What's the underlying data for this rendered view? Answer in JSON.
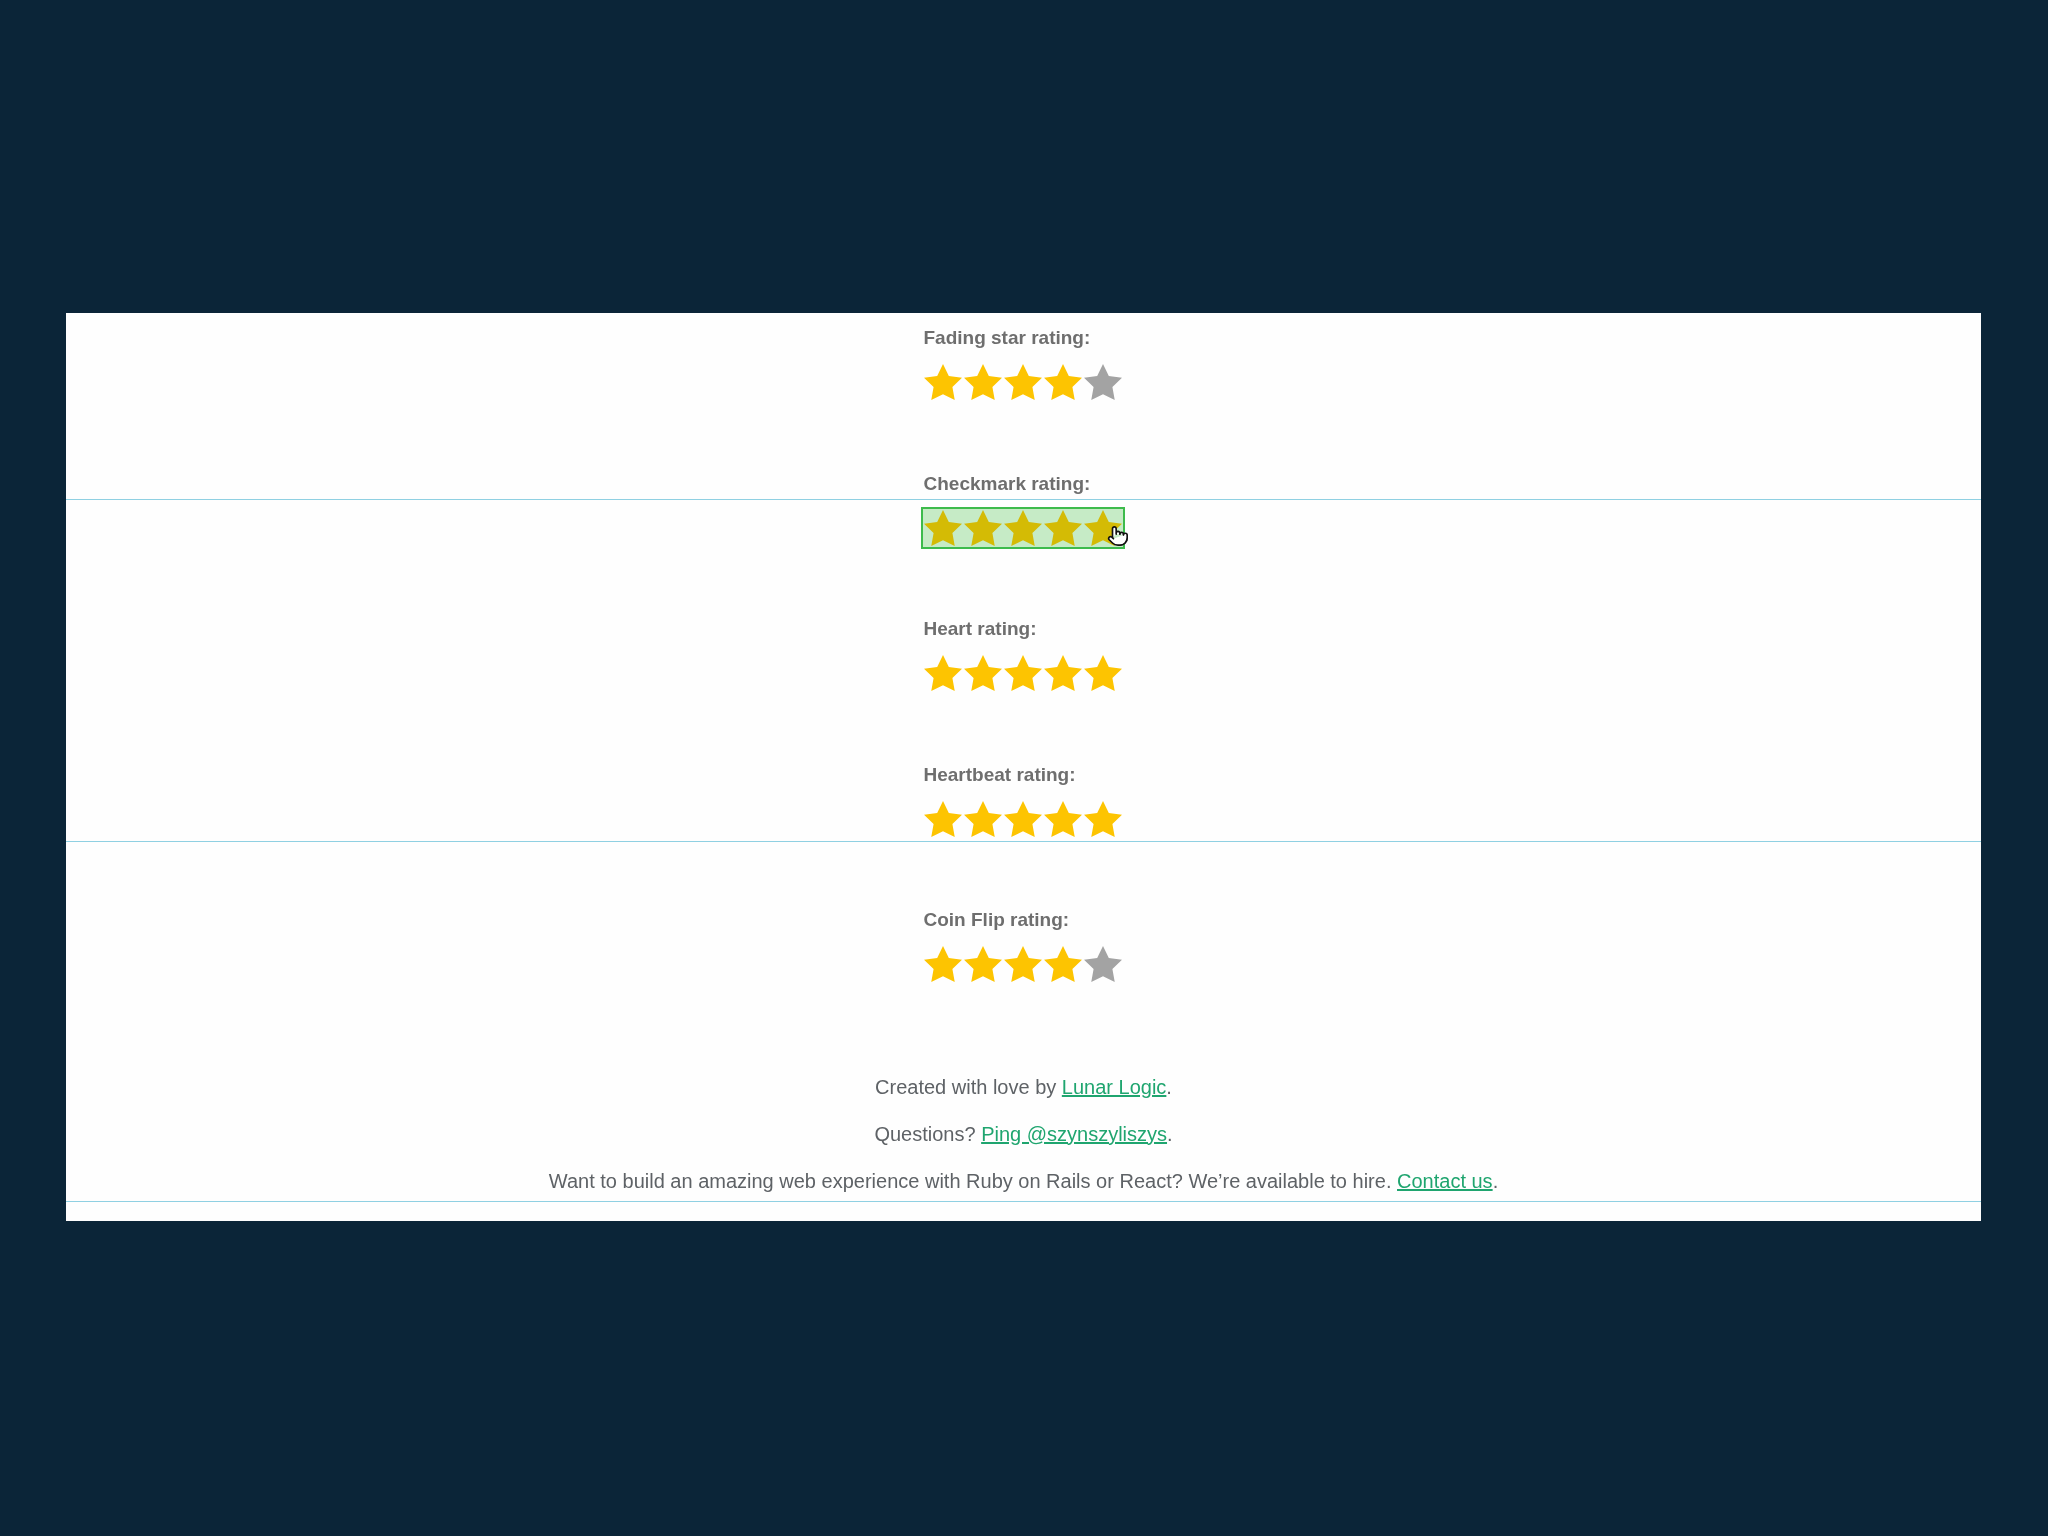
{
  "ratings": [
    {
      "label": "Fading star rating:",
      "stars": 4,
      "highlighted": false
    },
    {
      "label": "Checkmark rating:",
      "stars": 5,
      "highlighted": true
    },
    {
      "label": "Heart rating:",
      "stars": 5,
      "highlighted": false
    },
    {
      "label": "Heartbeat rating:",
      "stars": 5,
      "highlighted": false
    },
    {
      "label": "Coin Flip rating:",
      "stars": 4,
      "highlighted": false
    }
  ],
  "footer": [
    {
      "before": "Created with love by ",
      "link": "Lunar Logic",
      "after": "."
    },
    {
      "before": "Questions? ",
      "link": "Ping @szynszyliszys",
      "after": "."
    },
    {
      "before": "Want to build an amazing web experience with Ruby on Rails or React? We’re available to hire. ",
      "link": "Contact us",
      "after": "."
    }
  ]
}
